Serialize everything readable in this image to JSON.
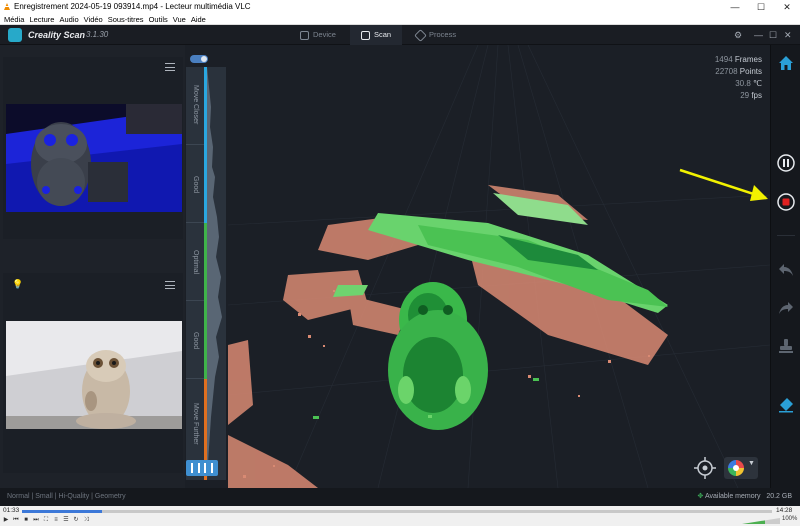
{
  "vlc": {
    "title": "Enregistrement 2024-05-19 093914.mp4 - Lecteur multimédia VLC",
    "menu": [
      "Média",
      "Lecture",
      "Audio",
      "Vidéo",
      "Sous-titres",
      "Outils",
      "Vue",
      "Aide"
    ],
    "time_current": "01:33",
    "time_total": "14:28",
    "progress": 0.107,
    "volume_percent": "100%"
  },
  "app": {
    "name": "Creality Scan",
    "version": "3.1.30",
    "tabs": [
      {
        "label": "Device",
        "icon": "device-icon",
        "active": false
      },
      {
        "label": "Scan",
        "icon": "scan-icon",
        "active": true
      },
      {
        "label": "Process",
        "icon": "process-icon",
        "active": false
      }
    ]
  },
  "meter": {
    "labels": [
      "Move Closer",
      "Good",
      "Optimal",
      "Good",
      "Move Further"
    ]
  },
  "stats": {
    "frames_value": "1494",
    "frames_unit": "Frames",
    "points_value": "22708",
    "points_unit": "Points",
    "temp_value": "30.8",
    "temp_unit": "℃",
    "fps_value": "29",
    "fps_unit": "fps"
  },
  "status": {
    "scan_mode": "Normal | Small | Hi-Quality | Geometry",
    "memory_label": "Available memory",
    "memory_value": "20.2 GB"
  },
  "colors": {
    "accent": "#27a9c9",
    "record_red": "#e02020",
    "annotation_arrow": "#f2f200",
    "meter_blue": "#2aa7e0",
    "meter_green": "#3fb34a",
    "meter_orange": "#e07020"
  }
}
